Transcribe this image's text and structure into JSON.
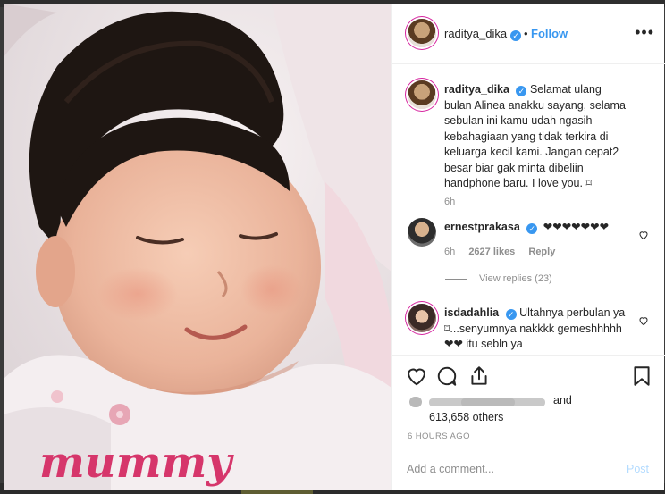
{
  "post": {
    "username": "raditya_dika",
    "follow_label": "Follow",
    "separator": "•",
    "more_label": "•••",
    "verified_glyph": "✓"
  },
  "caption": {
    "username": "raditya_dika",
    "text": "Selamat ulang bulan Alinea anakku sayang, selama sebulan ini kamu udah ngasih kebahagiaan yang tidak terkira di keluarga kecil kami. Jangan cepat2 besar biar gak minta dibeliin handphone baru. I love you. ⌑",
    "time": "6h"
  },
  "comments": [
    {
      "username": "ernestprakasa",
      "text": "❤❤❤❤❤❤❤",
      "time": "6h",
      "likes": "2627 likes",
      "reply_label": "Reply",
      "view_replies": "View replies (23)"
    },
    {
      "username": "isdadahlia",
      "text": "Ultahnya perbulan ya ⌑...senyumnya nakkkk gemeshhhhh❤❤ itu sebln ya"
    }
  ],
  "likes": {
    "and_label": "and",
    "others": "613,658 others"
  },
  "timestamp": "6 HOURS AGO",
  "add_comment": {
    "placeholder": "Add a comment...",
    "post_label": "Post"
  },
  "icons": [
    "heart-icon",
    "comment-icon",
    "share-icon",
    "bookmark-icon",
    "more-icon"
  ],
  "colors": {
    "link": "#3897f0",
    "verified": "#3897f0",
    "muted": "#8e8e8e",
    "post_disabled": "#b3dbff"
  }
}
